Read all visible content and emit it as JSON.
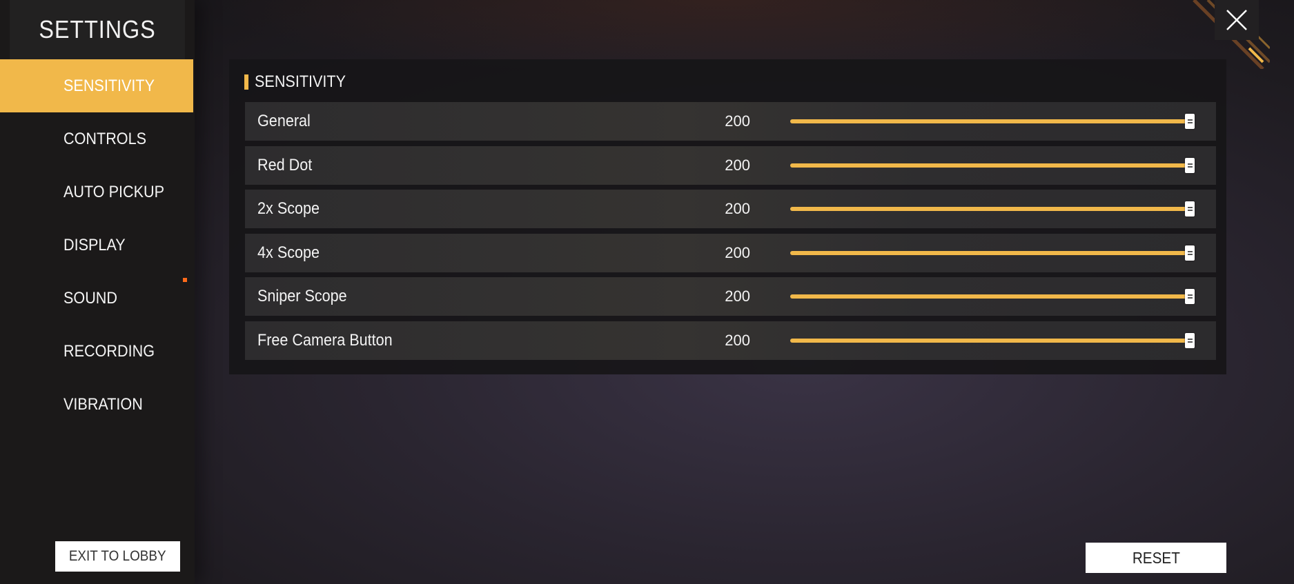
{
  "sidebar": {
    "title": "SETTINGS",
    "items": [
      {
        "id": "sensitivity",
        "label": "SENSITIVITY",
        "active": true
      },
      {
        "id": "controls",
        "label": "CONTROLS",
        "active": false
      },
      {
        "id": "auto-pickup",
        "label": "AUTO PICKUP",
        "active": false
      },
      {
        "id": "display",
        "label": "DISPLAY",
        "active": false
      },
      {
        "id": "sound",
        "label": "SOUND",
        "active": false
      },
      {
        "id": "recording",
        "label": "RECORDING",
        "active": false
      },
      {
        "id": "vibration",
        "label": "VIBRATION",
        "active": false
      }
    ],
    "exit_label": "EXIT TO LOBBY"
  },
  "panel": {
    "title": "SENSITIVITY",
    "slider_max": 200,
    "rows": [
      {
        "label": "General",
        "value": 200
      },
      {
        "label": "Red Dot",
        "value": 200
      },
      {
        "label": "2x Scope",
        "value": 200
      },
      {
        "label": "4x Scope",
        "value": 200
      },
      {
        "label": "Sniper Scope",
        "value": 200
      },
      {
        "label": "Free Camera Button",
        "value": 200
      }
    ]
  },
  "footer": {
    "reset_label": "RESET"
  },
  "icons": {
    "close": "close-icon",
    "slider_handle": "slider-handle-icon"
  },
  "colors": {
    "accent": "#f1b84a",
    "sidebar_bg": "#1b1919",
    "panel_bg": "#161517",
    "button_bg": "#ffffff"
  }
}
